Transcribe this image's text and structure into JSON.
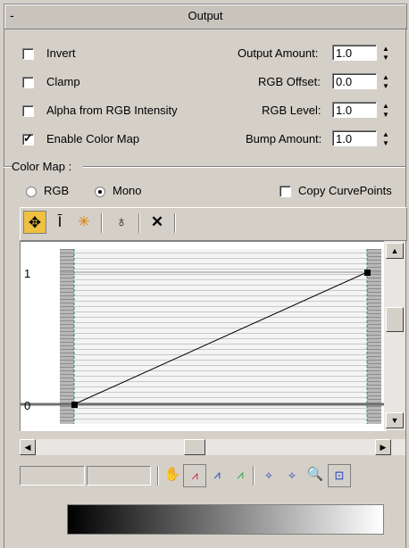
{
  "rollout": {
    "collapse_symbol": "-",
    "title": "Output"
  },
  "options": {
    "invert": {
      "label": "Invert",
      "checked": false
    },
    "clamp": {
      "label": "Clamp",
      "checked": false
    },
    "alpha_from_rgb": {
      "label": "Alpha from RGB Intensity",
      "checked": false
    },
    "enable_color_map": {
      "label": "Enable Color Map",
      "checked": true
    }
  },
  "spinners": {
    "output_amount": {
      "label": "Output Amount:",
      "value": "1.0"
    },
    "rgb_offset": {
      "label": "RGB Offset:",
      "value": "0.0"
    },
    "rgb_level": {
      "label": "RGB Level:",
      "value": "1.0"
    },
    "bump_amount": {
      "label": "Bump Amount:",
      "value": "1.0"
    }
  },
  "color_map": {
    "group_label": "Color Map :",
    "rgb_label": "RGB",
    "mono_label": "Mono",
    "selected_mode": "Mono",
    "copy_curve_points_label": "Copy CurvePoints",
    "copy_curve_points_checked": false
  },
  "graph": {
    "y_top_label": "1",
    "y_bottom_label": "0",
    "curve_points": [
      {
        "x": 0.0,
        "y": 0.0
      },
      {
        "x": 1.0,
        "y": 1.0
      }
    ]
  },
  "toolbar_icons": [
    "move-icon",
    "scale-point-icon",
    "add-point-icon",
    "reset-curves-icon",
    "delete-point-icon"
  ],
  "bottom_toolbar_icons": [
    "pan-icon",
    "zoom-extents-icon",
    "zoom-horizontal-extents-icon",
    "zoom-value-extents-icon",
    "zoom-horizontally-icon",
    "zoom-vertically-icon",
    "zoom-icon",
    "zoom-region-icon"
  ],
  "bottom_fields": {
    "field_1": "",
    "field_2": ""
  },
  "colors": {
    "background": "#d4d0c8",
    "gradient_start": "#000000",
    "gradient_end": "#ffffff",
    "accent_move": "#f0c040"
  }
}
